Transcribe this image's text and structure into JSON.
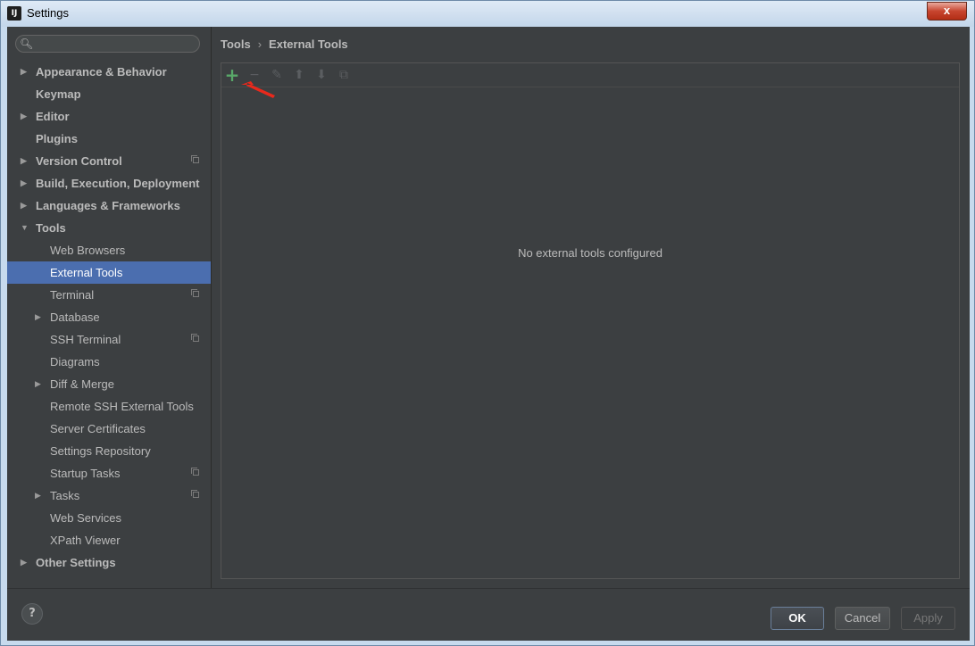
{
  "window": {
    "title": "Settings",
    "close_label": "x"
  },
  "search": {
    "placeholder": ""
  },
  "sidebar": {
    "items": [
      {
        "label": "Appearance & Behavior",
        "level": 0,
        "expandable": true,
        "expanded": false,
        "project": false
      },
      {
        "label": "Keymap",
        "level": 0,
        "expandable": false,
        "project": false
      },
      {
        "label": "Editor",
        "level": 0,
        "expandable": true,
        "expanded": false,
        "project": false
      },
      {
        "label": "Plugins",
        "level": 0,
        "expandable": false,
        "project": false
      },
      {
        "label": "Version Control",
        "level": 0,
        "expandable": true,
        "expanded": false,
        "project": true
      },
      {
        "label": "Build, Execution, Deployment",
        "level": 0,
        "expandable": true,
        "expanded": false,
        "project": false
      },
      {
        "label": "Languages & Frameworks",
        "level": 0,
        "expandable": true,
        "expanded": false,
        "project": false
      },
      {
        "label": "Tools",
        "level": 0,
        "expandable": true,
        "expanded": true,
        "project": false
      },
      {
        "label": "Web Browsers",
        "level": 1,
        "expandable": false,
        "project": false
      },
      {
        "label": "External Tools",
        "level": 1,
        "expandable": false,
        "project": false,
        "selected": true
      },
      {
        "label": "Terminal",
        "level": 1,
        "expandable": false,
        "project": true
      },
      {
        "label": "Database",
        "level": 1,
        "expandable": true,
        "expanded": false,
        "project": false
      },
      {
        "label": "SSH Terminal",
        "level": 1,
        "expandable": false,
        "project": true
      },
      {
        "label": "Diagrams",
        "level": 1,
        "expandable": false,
        "project": false
      },
      {
        "label": "Diff & Merge",
        "level": 1,
        "expandable": true,
        "expanded": false,
        "project": false
      },
      {
        "label": "Remote SSH External Tools",
        "level": 1,
        "expandable": false,
        "project": false
      },
      {
        "label": "Server Certificates",
        "level": 1,
        "expandable": false,
        "project": false
      },
      {
        "label": "Settings Repository",
        "level": 1,
        "expandable": false,
        "project": false
      },
      {
        "label": "Startup Tasks",
        "level": 1,
        "expandable": false,
        "project": true
      },
      {
        "label": "Tasks",
        "level": 1,
        "expandable": true,
        "expanded": false,
        "project": true
      },
      {
        "label": "Web Services",
        "level": 1,
        "expandable": false,
        "project": false
      },
      {
        "label": "XPath Viewer",
        "level": 1,
        "expandable": false,
        "project": false
      },
      {
        "label": "Other Settings",
        "level": 0,
        "expandable": true,
        "expanded": false,
        "project": false
      }
    ]
  },
  "breadcrumb": {
    "parent": "Tools",
    "separator": "›",
    "current": "External Tools"
  },
  "toolbar": {
    "buttons": [
      {
        "name": "add-icon",
        "glyph": "+",
        "enabled": true
      },
      {
        "name": "remove-icon",
        "glyph": "−",
        "enabled": false
      },
      {
        "name": "edit-icon",
        "glyph": "✎",
        "enabled": false
      },
      {
        "name": "move-up-icon",
        "glyph": "⬆",
        "enabled": false
      },
      {
        "name": "move-down-icon",
        "glyph": "⬇",
        "enabled": false
      },
      {
        "name": "copy-icon",
        "glyph": "⧉",
        "enabled": false
      }
    ]
  },
  "main": {
    "empty_text": "No external tools configured"
  },
  "annotation": {
    "color": "#e8291c"
  },
  "footer": {
    "help_label": "?",
    "ok_label": "OK",
    "cancel_label": "Cancel",
    "apply_label": "Apply"
  },
  "colors": {
    "background": "#3c3f41",
    "selection": "#4b6eaf",
    "text": "#bbbbbb",
    "add_green": "#59a869"
  }
}
